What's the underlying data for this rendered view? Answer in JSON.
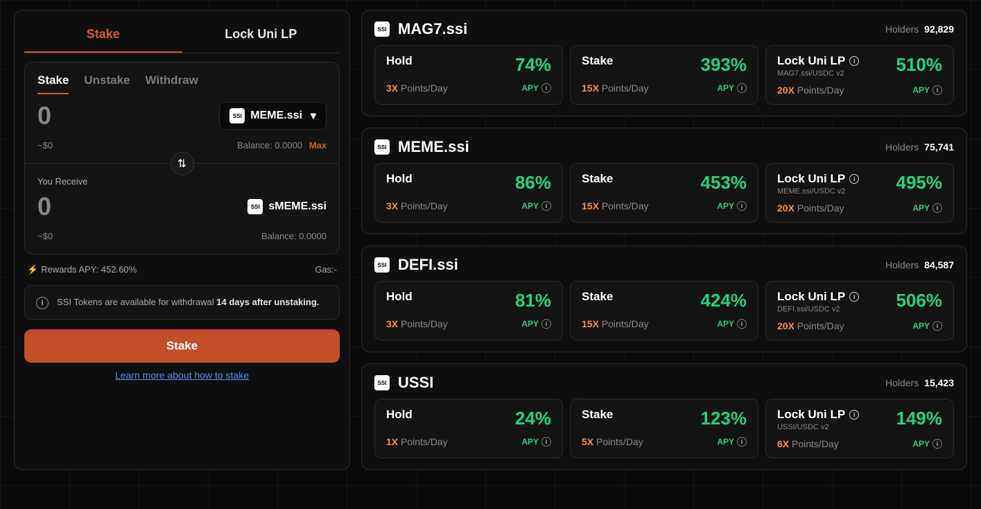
{
  "left": {
    "mainTabs": {
      "stake": "Stake",
      "lock": "Lock Uni LP"
    },
    "innerTabs": {
      "stake": "Stake",
      "unstake": "Unstake",
      "withdraw": "Withdraw"
    },
    "amount": "0",
    "amountUsd": "~$0",
    "token": "MEME.ssi",
    "balanceLabel": "Balance: 0.0000",
    "maxLabel": "Max",
    "receiveLabel": "You Receive",
    "receiveAmount": "0",
    "receiveUsd": "~$0",
    "receiveToken": "sMEME.ssi",
    "receiveBalance": "Balance: 0.0000",
    "rewardsApy": "Rewards APY: 452.60%",
    "gasLabel": "Gas:-",
    "infoText1": "SSI Tokens are available for withdrawal ",
    "infoText2": "14 days after unstaking.",
    "stakeBtn": "Stake",
    "learnLink": "Learn more about how to stake"
  },
  "common": {
    "holdersLabel": "Holders",
    "apyLabel": "APY",
    "ptsLabel": "Points/Day",
    "holdTitle": "Hold",
    "stakeTitle": "Stake",
    "lockTitle": "Lock Uni LP"
  },
  "assets": [
    {
      "name": "MAG7.ssi",
      "holders": "92,829",
      "hold": {
        "apy": "74%",
        "pts": "3X"
      },
      "stake": {
        "apy": "393%",
        "pts": "15X"
      },
      "lock": {
        "apy": "510%",
        "pts": "20X",
        "sub": "MAG7.ssi/USDC v2"
      }
    },
    {
      "name": "MEME.ssi",
      "holders": "75,741",
      "hold": {
        "apy": "86%",
        "pts": "3X"
      },
      "stake": {
        "apy": "453%",
        "pts": "15X"
      },
      "lock": {
        "apy": "495%",
        "pts": "20X",
        "sub": "MEME.ssi/USDC v2"
      }
    },
    {
      "name": "DEFI.ssi",
      "holders": "84,587",
      "hold": {
        "apy": "81%",
        "pts": "3X"
      },
      "stake": {
        "apy": "424%",
        "pts": "15X"
      },
      "lock": {
        "apy": "506%",
        "pts": "20X",
        "sub": "DEFI.ssi/USDC v2"
      }
    },
    {
      "name": "USSI",
      "holders": "15,423",
      "hold": {
        "apy": "24%",
        "pts": "1X"
      },
      "stake": {
        "apy": "123%",
        "pts": "5X"
      },
      "lock": {
        "apy": "149%",
        "pts": "6X",
        "sub": "USSI/USDC v2"
      }
    }
  ]
}
